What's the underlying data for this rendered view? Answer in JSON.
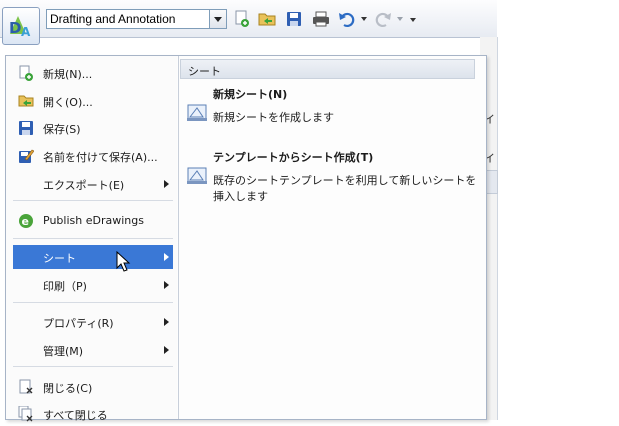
{
  "toolbar": {
    "workspace_value": "Drafting and Annotation",
    "icons": [
      "new-icon",
      "open-icon",
      "save-icon",
      "print-icon",
      "undo-icon",
      "redo-icon",
      "customize-icon"
    ]
  },
  "app_menu": {
    "items": [
      {
        "label": "新規(N)...",
        "icon": "new-document-icon"
      },
      {
        "label": "開く(O)...",
        "icon": "open-folder-icon"
      },
      {
        "label": "保存(S)",
        "icon": "save-disk-icon"
      },
      {
        "label": "名前を付けて保存(A)...",
        "icon": "save-as-icon"
      },
      {
        "label": "エクスポート(E)",
        "icon": ""
      },
      {
        "label": "Publish eDrawings",
        "icon": "edrawings-icon"
      },
      {
        "label": "シート",
        "icon": ""
      },
      {
        "label": "印刷（P)",
        "icon": ""
      },
      {
        "label": "プロパティ(R)",
        "icon": ""
      },
      {
        "label": "管理(M)",
        "icon": ""
      },
      {
        "label": "閉じる(C)",
        "icon": "close-document-icon"
      },
      {
        "label": "すべて閉じる",
        "icon": "close-all-icon"
      }
    ],
    "submenu": {
      "title": "シート",
      "items": [
        {
          "title": "新規シート(N)",
          "description": "新規シートを作成します"
        },
        {
          "title": "テンプレートからシート作成(T)",
          "description": "既存のシートテンプレートを利用して新しいシートを挿入します"
        }
      ]
    }
  },
  "background": {
    "fragment_1": "イ",
    "fragment_2": "イ"
  },
  "colors": {
    "highlight": "#3a78d6",
    "menu_border": "#a7b4c7"
  }
}
